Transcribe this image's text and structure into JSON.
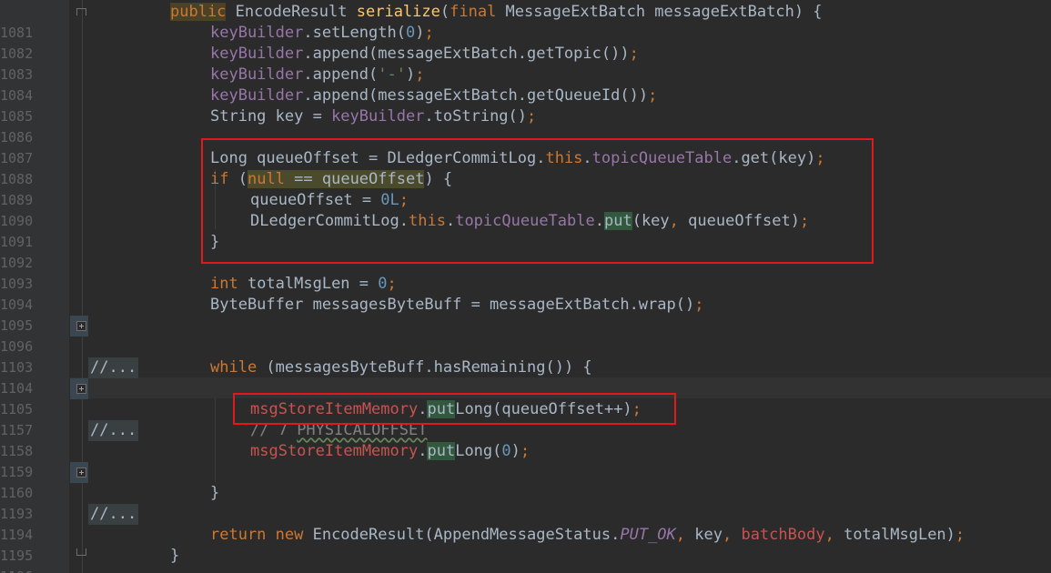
{
  "lines": {
    "l1081": {
      "num": "1081",
      "kw": "public",
      "type": "EncodeResult",
      "fn": "serialize",
      "rest_open": "(",
      "kw2": "final",
      "params": " MessageExtBatch messageExtBatch) {"
    },
    "l1082": {
      "num": "1082",
      "field": "keyBuilder",
      "a": ".setLength(",
      "n": "0",
      "b": ")",
      "semi": ";"
    },
    "l1083": {
      "num": "1083",
      "field": "keyBuilder",
      "a": ".append(messageExtBatch.getTopic())",
      "semi": ";"
    },
    "l1084": {
      "num": "1084",
      "field": "keyBuilder",
      "a": ".append(",
      "s": "'-'",
      "b": ")",
      "semi": ";"
    },
    "l1085": {
      "num": "1085",
      "field": "keyBuilder",
      "a": ".append(messageExtBatch.getQueueId())",
      "semi": ";"
    },
    "l1086": {
      "num": "1086",
      "a": "String key = ",
      "field": "keyBuilder",
      "b": ".toString()",
      "semi": ";"
    },
    "l1087": {
      "num": "1087"
    },
    "l1088": {
      "num": "1088",
      "a": "Long queueOffset = DLedgerCommitLog.",
      "kw": "this",
      "b": ".",
      "field": "topicQueueTable",
      "c": ".get(key)",
      "semi": ";"
    },
    "l1089": {
      "num": "1089",
      "kw": "if",
      "a": " (",
      "null_kw": "null",
      "cond": " == queueOffset",
      "b": ") {"
    },
    "l1090": {
      "num": "1090",
      "a": "queueOffset = ",
      "n": "0L",
      "semi": ";"
    },
    "l1091": {
      "num": "1091",
      "a": "DLedgerCommitLog.",
      "kw": "this",
      "b": ".",
      "field": "topicQueueTable",
      "c": ".",
      "put": "put",
      "d": "(key",
      "comma": ",",
      "e": " queueOffset)",
      "semi": ";"
    },
    "l1092": {
      "num": "1092",
      "a": "}"
    },
    "l1093": {
      "num": "1093"
    },
    "l1094": {
      "num": "1094",
      "kw": "int",
      "a": " totalMsgLen = ",
      "n": "0",
      "semi": ";"
    },
    "l1095": {
      "num": "1095",
      "a": "ByteBuffer messagesByteBuff = messageExtBatch.wrap()",
      "semi": ";"
    },
    "l1096": {
      "num": "1096",
      "fold": "//..."
    },
    "l1103": {
      "num": "1103"
    },
    "l1104": {
      "num": "1104",
      "kw": "while",
      "a": " (messagesByteBuff.hasRemaining()) {"
    },
    "l1105": {
      "num": "1105",
      "fold": "//..."
    },
    "l1157": {
      "num": "1157",
      "pink": "msgStoreItemMemory",
      "a": ".",
      "put": "put",
      "b": "Long(queueOffset++)",
      "semi": ";"
    },
    "l1158": {
      "num": "1158",
      "cm": "// 7 ",
      "cm_typo": "PHYSICALOFFSET"
    },
    "l1159": {
      "num": "1159",
      "pink": "msgStoreItemMemory",
      "a": ".",
      "put": "put",
      "b": "Long(",
      "n": "0",
      "c": ")",
      "semi": ";"
    },
    "l1160": {
      "num": "1160",
      "fold": "//..."
    },
    "l1193": {
      "num": "1193",
      "a": "}"
    },
    "l1194": {
      "num": "1194"
    },
    "l1195": {
      "num": "1195",
      "kw": "return new",
      "a": " EncodeResult(AppendMessageStatus.",
      "const": "PUT_OK",
      "comma1": ",",
      "b": " key",
      "comma2": ",",
      "pink": " batchBody",
      "comma3": ",",
      "c": " totalMsgLen)",
      "semi": ";"
    },
    "l1196": {
      "num": "1196",
      "a": "}"
    }
  },
  "colors": {
    "background": "#2b2b2b",
    "gutter": "#313335",
    "keyword": "#cc7832",
    "function": "#ffc66d",
    "field": "#9876aa",
    "number": "#6897bb",
    "string": "#6a8759",
    "comment": "#808080",
    "highlight_box": "#e3181b"
  }
}
